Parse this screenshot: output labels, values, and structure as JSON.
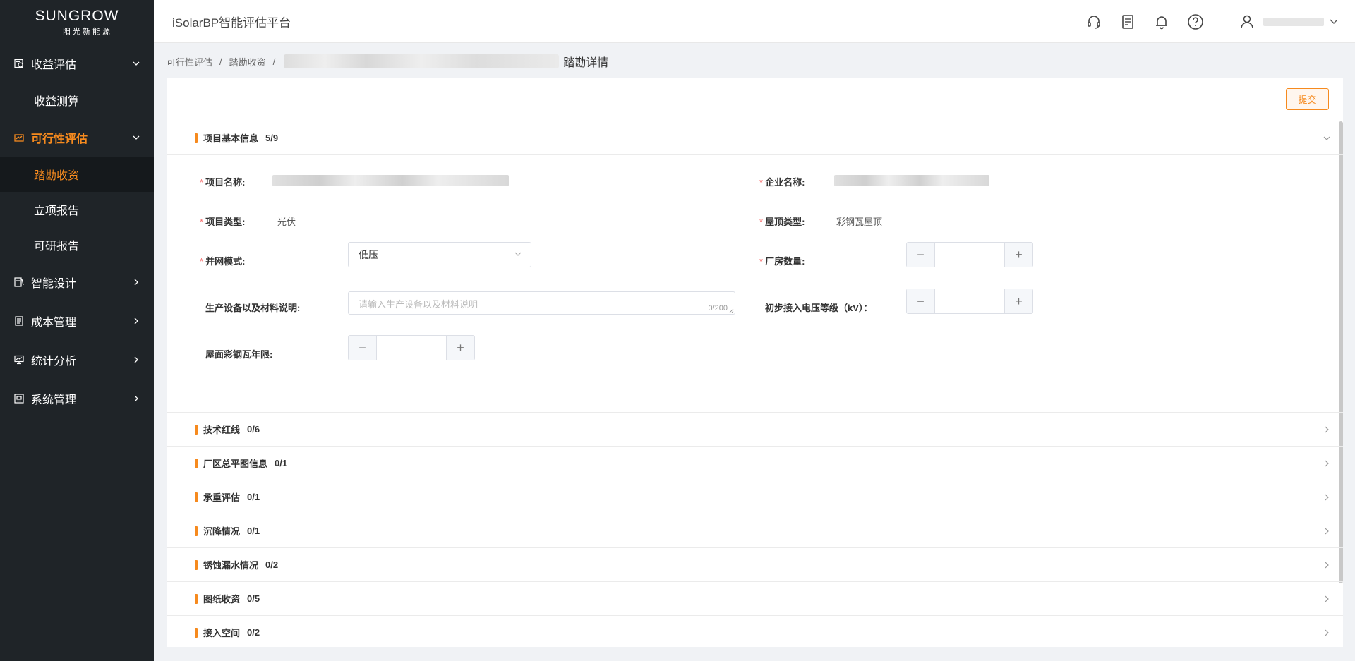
{
  "brand": {
    "logo_text": "SUNGROW",
    "logo_sub": "阳光新能源"
  },
  "header": {
    "title": "iSolarBP智能评估平台"
  },
  "sidebar": {
    "items": [
      {
        "label": "收益评估",
        "icon": "revenue-icon",
        "expanded": true
      },
      {
        "label": "收益测算"
      },
      {
        "label": "可行性评估",
        "icon": "feasibility-icon",
        "expanded": true
      },
      {
        "label": "踏勘收资"
      },
      {
        "label": "立项报告"
      },
      {
        "label": "可研报告"
      },
      {
        "label": "智能设计",
        "icon": "design-icon",
        "expanded": false
      },
      {
        "label": "成本管理",
        "icon": "cost-icon",
        "expanded": false
      },
      {
        "label": "统计分析",
        "icon": "stats-icon",
        "expanded": false
      },
      {
        "label": "系统管理",
        "icon": "system-icon",
        "expanded": false
      }
    ]
  },
  "breadcrumb": {
    "items": [
      "可行性评估",
      "踏勘收资"
    ],
    "current": "踏勘详情"
  },
  "toolbar": {
    "submit_label": "提交"
  },
  "sections": [
    {
      "title": "项目基本信息",
      "count": "5/9",
      "expanded": true
    },
    {
      "title": "技术红线",
      "count": "0/6"
    },
    {
      "title": "厂区总平图信息",
      "count": "0/1"
    },
    {
      "title": "承重评估",
      "count": "0/1"
    },
    {
      "title": "沉降情况",
      "count": "0/1"
    },
    {
      "title": "锈蚀漏水情况",
      "count": "0/2"
    },
    {
      "title": "图纸收资",
      "count": "0/5"
    },
    {
      "title": "接入空间",
      "count": "0/2"
    }
  ],
  "form": {
    "project_name_label": "项目名称:",
    "company_name_label": "企业名称:",
    "project_type_label": "项目类型:",
    "project_type_value": "光伏",
    "roof_type_label": "屋顶类型:",
    "roof_type_value": "彩钢瓦屋顶",
    "grid_mode_label": "并网模式:",
    "grid_mode_value": "低压",
    "factory_count_label": "厂房数量:",
    "equipment_label": "生产设备以及材料说明:",
    "equipment_placeholder": "请输入生产设备以及材料说明",
    "equipment_count": "0/200",
    "voltage_label": "初步接入电压等级（kV）：",
    "roof_years_label": "屋面彩钢瓦年限:"
  },
  "colors": {
    "accent": "#f68a1e",
    "sidebar_bg": "#1f2428",
    "required": "#f56c6c"
  }
}
